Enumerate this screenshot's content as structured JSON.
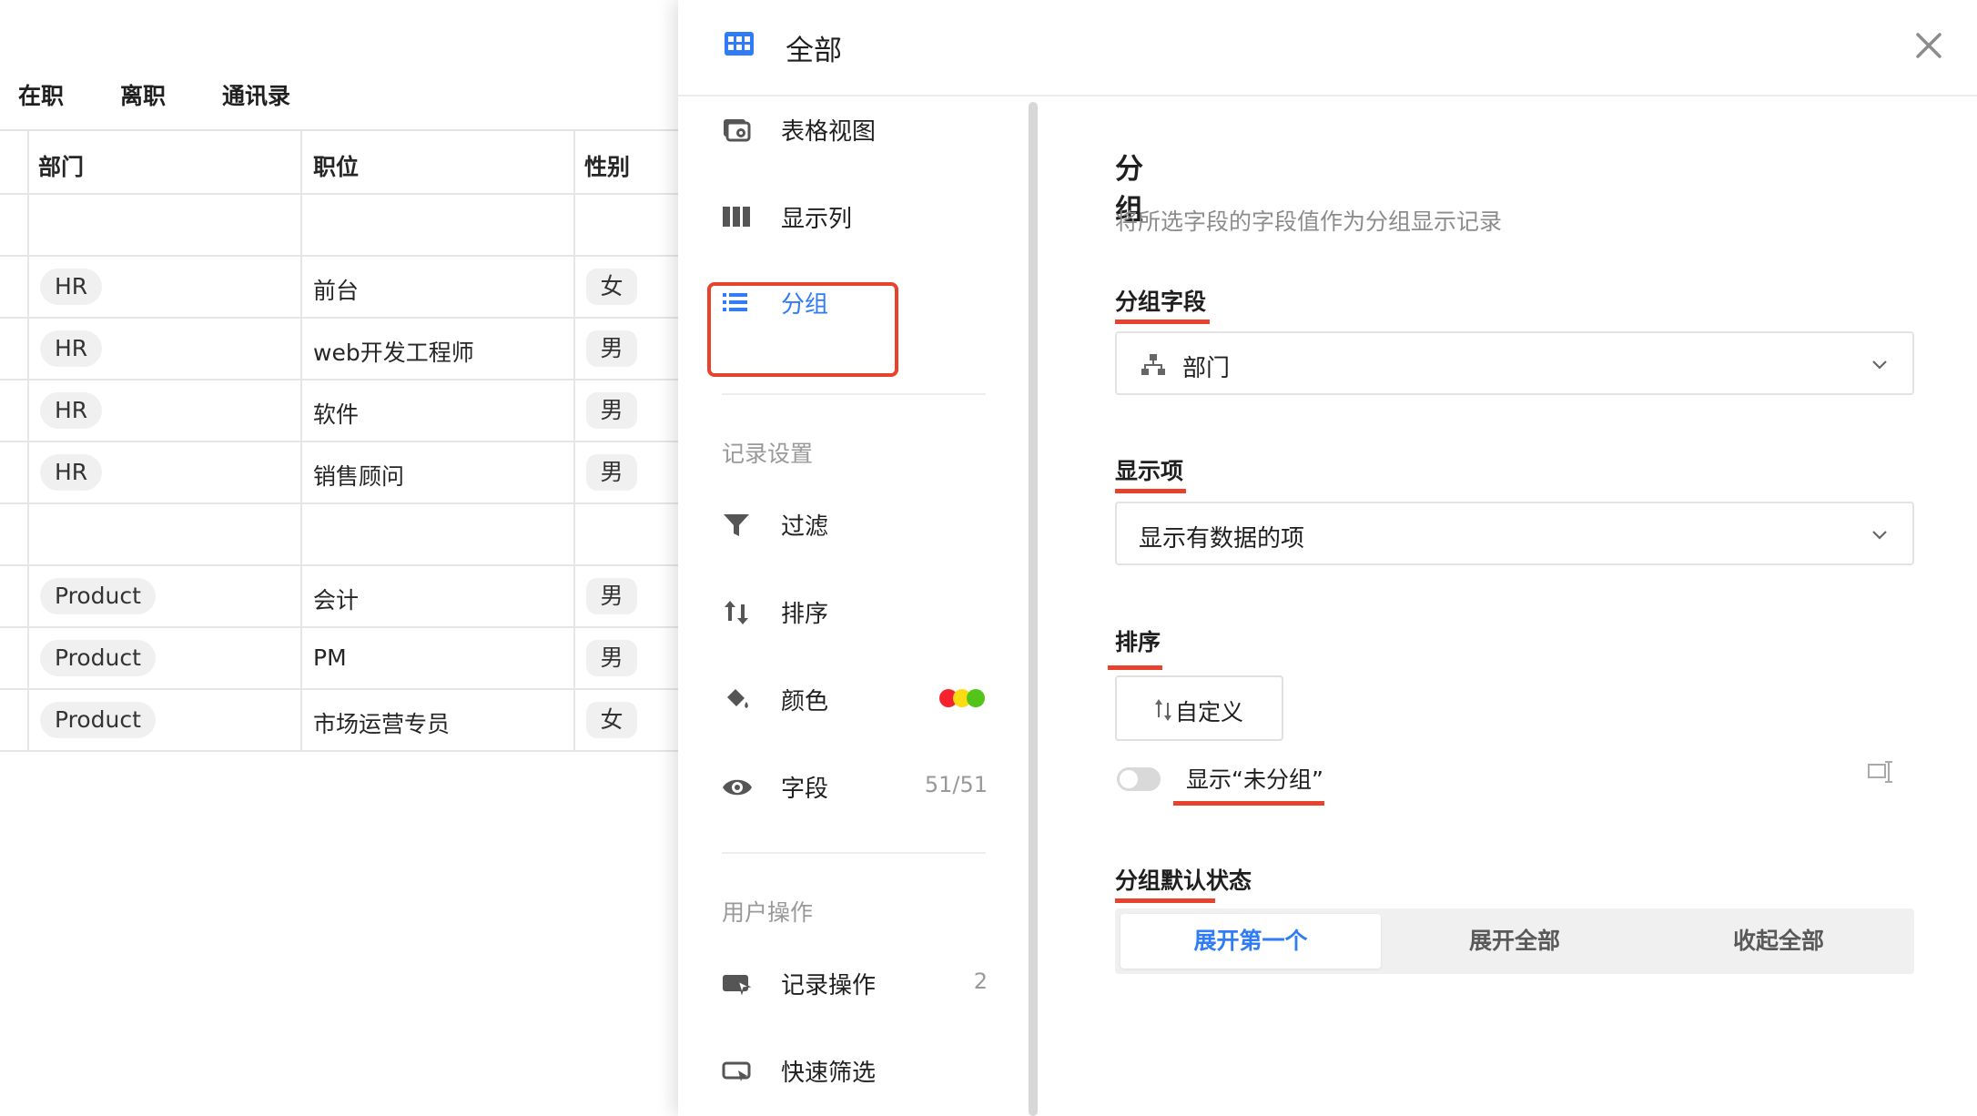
{
  "tabs": [
    "在职",
    "离职",
    "通讯录"
  ],
  "table": {
    "headers": [
      "部门",
      "职位",
      "性别"
    ],
    "rows": [
      {
        "dept": "HR",
        "position": "前台",
        "gender": "女"
      },
      {
        "dept": "HR",
        "position": "web开发工程师",
        "gender": "男"
      },
      {
        "dept": "HR",
        "position": "软件",
        "gender": "男"
      },
      {
        "dept": "HR",
        "position": "销售顾问",
        "gender": "男"
      },
      {
        "dept": "Product",
        "position": "会计",
        "gender": "男"
      },
      {
        "dept": "Product",
        "position": "PM",
        "gender": "男"
      },
      {
        "dept": "Product",
        "position": "市场运营专员",
        "gender": "女"
      }
    ]
  },
  "drawer": {
    "title": "全部",
    "menu": {
      "table_view": "表格视图",
      "columns": "显示列",
      "group": "分组",
      "section_record": "记录设置",
      "filter": "过滤",
      "sort": "排序",
      "color": "颜色",
      "fields": "字段",
      "fields_count": "51/51",
      "section_user": "用户操作",
      "record_actions": "记录操作",
      "record_actions_count": "2",
      "quick_filter": "快速筛选"
    },
    "panel": {
      "title": "分组",
      "description": "将所选字段的字段值作为分组显示记录",
      "group_field_label": "分组字段",
      "group_field_value": "部门",
      "display_label": "显示项",
      "display_value": "显示有数据的项",
      "sort_label": "排序",
      "sort_button": "自定义",
      "show_ungrouped": "显示“未分组”",
      "default_state_label": "分组默认状态",
      "default_state_options": [
        "展开第一个",
        "展开全部",
        "收起全部"
      ],
      "default_state_selected": "展开第一个"
    }
  },
  "colors": {
    "accent": "#2f7cf6",
    "highlight": "#e8412c",
    "color_dots": [
      "#f5222d",
      "#fadb14",
      "#52c41a"
    ]
  }
}
